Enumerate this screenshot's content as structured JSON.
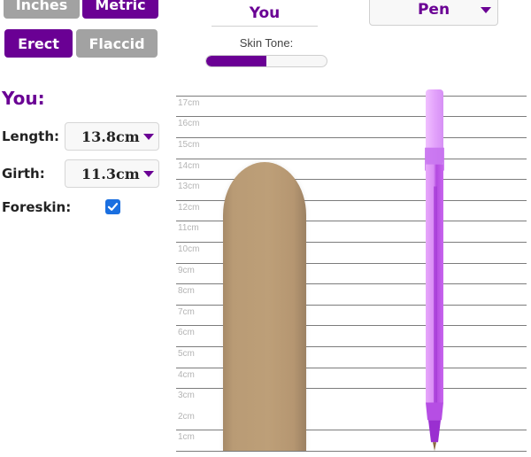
{
  "units": {
    "inches_label": "Inches",
    "metric_label": "Metric",
    "selected": "Metric"
  },
  "state": {
    "erect_label": "Erect",
    "flaccid_label": "Flaccid",
    "selected": "Erect"
  },
  "header": {
    "you_tab": "You",
    "skin_tone_label": "Skin Tone:",
    "skin_tone_value": 0.5
  },
  "compare": {
    "selected": "Pen"
  },
  "you_panel": {
    "heading": "You:",
    "length_label": "Length:",
    "length_value": "13.8cm",
    "length_cm": 13.8,
    "girth_label": "Girth:",
    "girth_value": "11.3cm",
    "foreskin_label": "Foreskin:",
    "foreskin_checked": true
  },
  "ruler": {
    "labels": [
      "17cm",
      "16cm",
      "15cm",
      "14cm",
      "13cm",
      "12cm",
      "11cm",
      "10cm",
      "9cm",
      "8cm",
      "7cm",
      "6cm",
      "5cm",
      "4cm",
      "3cm",
      "2cm",
      "1cm"
    ],
    "max_cm": 17
  },
  "compare_object": {
    "name": "Pen",
    "length_cm": 17.3
  },
  "colors": {
    "accent": "#6a0094",
    "inactive_button": "#a2a2a2",
    "skin": "#bd9f78",
    "pen": "#d98cf5",
    "checkbox": "#1a6fe0"
  }
}
